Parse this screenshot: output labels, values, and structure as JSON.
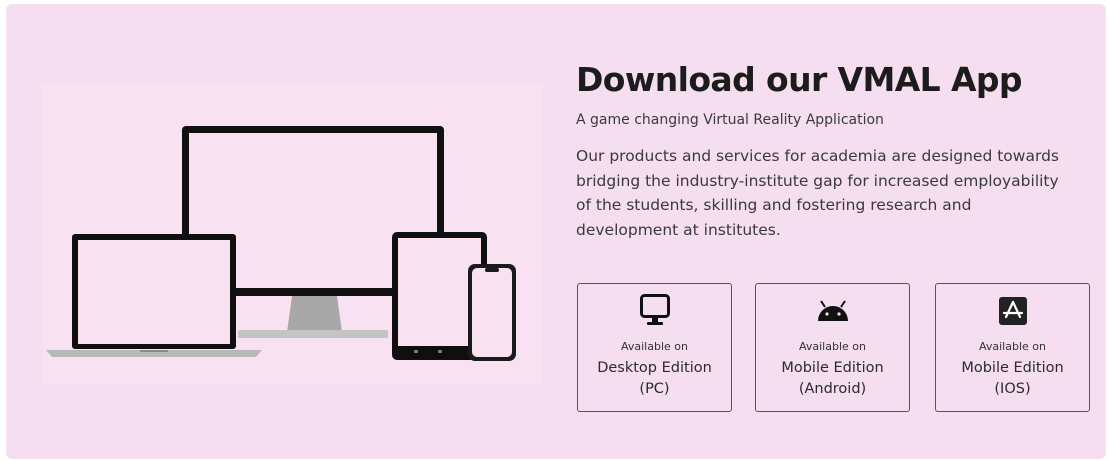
{
  "hero": {
    "title": "Download our VMAL App",
    "subtitle": "A game changing Virtual Reality Application",
    "description": "Our products and services for academia are designed towards bridging the industry-institute gap for increased employability of the students, skilling and fostering research and development at institutes."
  },
  "downloads": [
    {
      "available_label": "Available on",
      "edition": "Desktop Edition",
      "platform": "(PC)",
      "icon": "monitor-icon"
    },
    {
      "available_label": "Available on",
      "edition": "Mobile Edition",
      "platform": "(Android)",
      "icon": "android-icon"
    },
    {
      "available_label": "Available on",
      "edition": "Mobile Edition",
      "platform": "(IOS)",
      "icon": "app-store-icon"
    }
  ],
  "colors": {
    "background": "#f5deef",
    "text": "#1c1c1c",
    "border": "#555555"
  }
}
